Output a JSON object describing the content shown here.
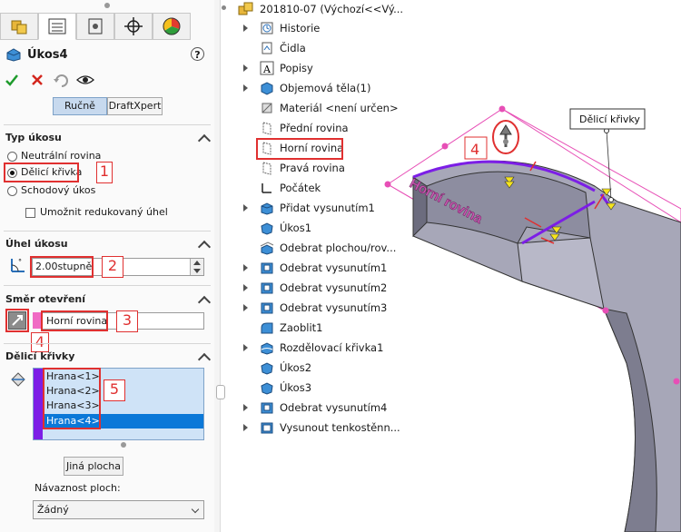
{
  "pm": {
    "feature_name": "Úkos4",
    "help_label": "?",
    "mode_tabs": [
      "Ručně",
      "DraftXpert"
    ],
    "sections": {
      "type": {
        "title": "Typ úkosu",
        "options": [
          "Neutrální rovina",
          "Dělicí křivka",
          "Schodový úkos"
        ],
        "selected_index": 1,
        "checkbox_label": "Umožnit redukovaný úhel"
      },
      "angle": {
        "title": "Úhel úkosu",
        "value": "2.00stupně"
      },
      "direction": {
        "title": "Směr otevření",
        "value": "Horní rovina"
      },
      "curves": {
        "title": "Dělicí křivky",
        "items": [
          "Hrana<1>",
          "Hrana<2>",
          "Hrana<3>",
          "Hrana<4>"
        ],
        "selected_index": 3,
        "other_face_label": "Jiná plocha",
        "continuity_label": "Návaznost ploch:",
        "continuity_value": "Žádný"
      }
    },
    "callouts": [
      "1",
      "2",
      "3",
      "4",
      "5"
    ]
  },
  "tree": {
    "root": "201810-07  (Výchozí<<Vý...",
    "items": [
      {
        "label": "Historie",
        "icon": "history-icon",
        "expandable": true
      },
      {
        "label": "Čidla",
        "icon": "sensor-icon",
        "expandable": false
      },
      {
        "label": "Popisy",
        "icon": "annotation-icon",
        "expandable": true
      },
      {
        "label": "Objemová těla(1)",
        "icon": "solid-bodies-icon",
        "expandable": true
      },
      {
        "label": "Materiál <není určen>",
        "icon": "material-icon",
        "expandable": false
      },
      {
        "label": "Přední rovina",
        "icon": "plane-icon",
        "expandable": false
      },
      {
        "label": "Horní rovina",
        "icon": "plane-icon",
        "expandable": false
      },
      {
        "label": "Pravá rovina",
        "icon": "plane-icon",
        "expandable": false
      },
      {
        "label": "Počátek",
        "icon": "origin-icon",
        "expandable": false
      },
      {
        "label": "Přidat vysunutím1",
        "icon": "extrude-icon",
        "expandable": true
      },
      {
        "label": "Úkos1",
        "icon": "draft-icon",
        "expandable": false
      },
      {
        "label": "Odebrat plochou/rov...",
        "icon": "cut-surface-icon",
        "expandable": false
      },
      {
        "label": "Odebrat vysunutím1",
        "icon": "cut-extrude-icon",
        "expandable": true
      },
      {
        "label": "Odebrat vysunutím2",
        "icon": "cut-extrude-icon",
        "expandable": true
      },
      {
        "label": "Odebrat vysunutím3",
        "icon": "cut-extrude-icon",
        "expandable": true
      },
      {
        "label": "Zaoblit1",
        "icon": "fillet-icon",
        "expandable": false
      },
      {
        "label": "Rozdělovací křivka1",
        "icon": "split-line-icon",
        "expandable": true
      },
      {
        "label": "Úkos2",
        "icon": "draft-icon",
        "expandable": false
      },
      {
        "label": "Úkos3",
        "icon": "draft-icon",
        "expandable": false
      },
      {
        "label": "Odebrat vysunutím4",
        "icon": "cut-extrude-icon",
        "expandable": true
      },
      {
        "label": "Vysunout tenkostěnn...",
        "icon": "thin-extrude-icon",
        "expandable": true
      }
    ]
  },
  "viewport": {
    "plane_label": "Horní rovina",
    "tooltip": "Dělicí křivky",
    "callout": "4"
  },
  "colors": {
    "accent_red": "#e03030",
    "selection_blue": "#0b78d8",
    "list_bg": "#cfe3f7",
    "purple": "#7c1ee6",
    "plane_pink": "#e74fb6",
    "part_gray": "#a3a3b3"
  }
}
